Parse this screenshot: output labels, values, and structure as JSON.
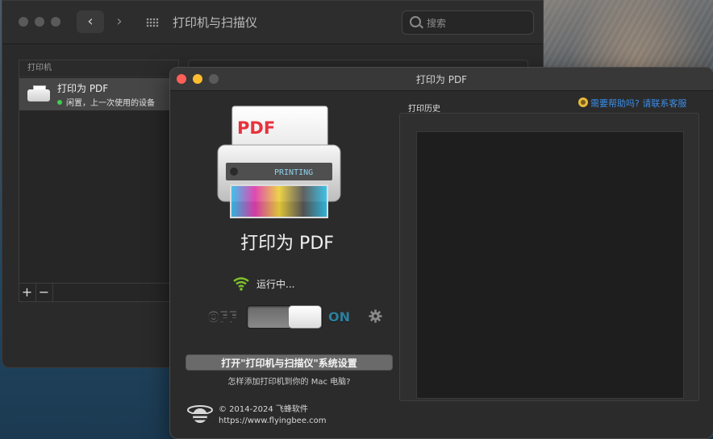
{
  "back_window": {
    "title": "打印机与扫描仪",
    "nav_back": "‹",
    "nav_forward": "›",
    "search_placeholder": "搜索",
    "printers_header": "打印机",
    "printers": [
      {
        "name": "打印为 PDF",
        "status": "闲置，上一次使用的设备"
      }
    ],
    "add_label": "+",
    "remove_label": "−"
  },
  "front_window": {
    "title": "打印为 PDF",
    "art": {
      "pdf_text": "PDF",
      "printing_text": "PRINTING"
    },
    "app_name": "打印为 PDF",
    "status_text": "运行中...",
    "toggle": {
      "off_label": "OFF",
      "on_label": "ON",
      "state": "on"
    },
    "open_settings_button": "打开\"打印机与扫描仪\"系统设置",
    "how_to_add_link": "怎样添加打印机到你的 Mac 电脑?",
    "copyright": "© 2014-2024 飞蜂软件",
    "website": "https://www.flyingbee.com",
    "help_link": "需要帮助吗? 请联系客服",
    "history_label": "打印历史",
    "history_items": []
  },
  "colors": {
    "traffic_close": "#ff5f57",
    "traffic_minimize": "#febc2e",
    "traffic_zoom_inactive": "#5a5a5a",
    "status_green": "#3ccf4e",
    "link_blue": "#3b8de8",
    "on_label": "#2d7f9e"
  },
  "icons": {
    "search": "search-icon",
    "grid": "grid-icon",
    "wifi": "wifi-icon",
    "gear": "gear-icon",
    "help": "help-icon",
    "logo": "bee-logo"
  }
}
